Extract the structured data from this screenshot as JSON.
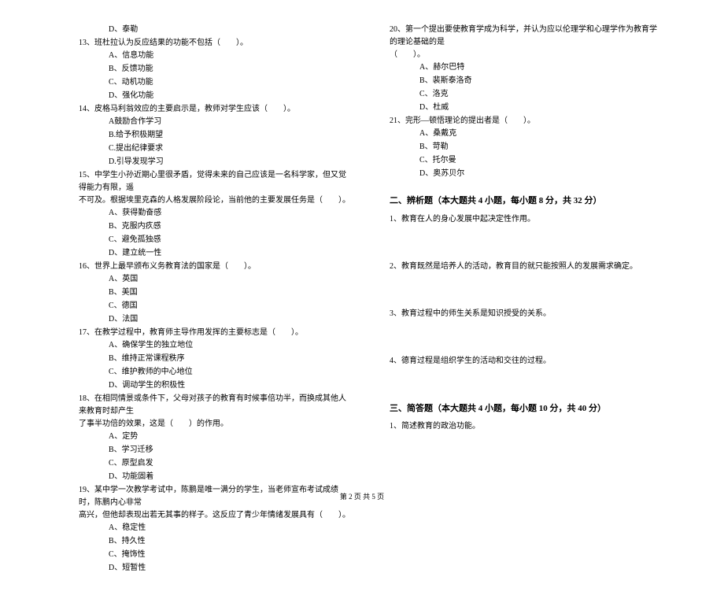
{
  "left": {
    "q12_optD": "D、泰勒",
    "q13_stem": "13、班杜拉认为反应结果的功能不包括（　　）。",
    "q13_A": "A、信息功能",
    "q13_B": "B、反馈功能",
    "q13_C": "C、动机功能",
    "q13_D": "D、强化功能",
    "q14_stem": "14、皮格马利翁效应的主要启示是，教师对学生应该（　　）。",
    "q14_A": "A鼓励合作学习",
    "q14_B": "B.给予积极期望",
    "q14_C": "C.提出纪律要求",
    "q14_D": "D.引导发现学习",
    "q15_stem1": "15、中学生小孙近期心里很矛盾，觉得未来的自己应该是一名科学家，但又觉得能力有限，遥",
    "q15_stem2": "不可及。根据埃里克森的人格发展阶段论，当前他的主要发展任务是（　　）。",
    "q15_A": "A、获得勤奋感",
    "q15_B": "B、克服内疚感",
    "q15_C": "C、避免孤独感",
    "q15_D": "D、建立统一性",
    "q16_stem": "16、世界上最早颁布义务教育法的国家是（　　）。",
    "q16_A": "A、英国",
    "q16_B": "B、美国",
    "q16_C": "C、德国",
    "q16_D": "D、法国",
    "q17_stem": "17、在教学过程中，教育师主导作用发挥的主要标志是（　　）。",
    "q17_A": "A、确保学生的独立地位",
    "q17_B": "B、维持正常课程秩序",
    "q17_C": "C、维护教师的中心地位",
    "q17_D": "D、调动学生的积极性",
    "q18_stem1": "18、在相同情景或条件下，父母对孩子的教育有时候事倍功半，而换成其他人来教育时却产生",
    "q18_stem2": "了事半功倍的效果，这是（　　）的作用。",
    "q18_A": "A、定势",
    "q18_B": "B、学习迁移",
    "q18_C": "C、原型启发",
    "q18_D": "D、功能固着",
    "q19_stem1": "19、某中学一次教学考试中，陈鹏是唯一满分的学生，当老师宣布考试成绩时，陈鹏内心非常",
    "q19_stem2": "高兴，但他却表现出若无其事的样子。这反应了青少年情绪发展具有（　　）。",
    "q19_A": "A、稳定性",
    "q19_B": "B、持久性",
    "q19_C": "C、掩饰性",
    "q19_D": "D、短暂性"
  },
  "right": {
    "q20_stem1": "20、第一个提出要使教育学成为科学，并认为应以伦理学和心理学作为教育学的理论基础的是",
    "q20_stem2": "（　　）。",
    "q20_A": "A、赫尔巴特",
    "q20_B": "B、裴斯泰洛奇",
    "q20_C": "C、洛克",
    "q20_D": "D、杜威",
    "q21_stem": "21、完形—顿悟理论的提出者是（　　）。",
    "q21_A": "A、桑戴克",
    "q21_B": "B、苛勒",
    "q21_C": "C、托尔曼",
    "q21_D": "D、奥苏贝尔",
    "section2_title": "二、辨析题（本大题共 4 小题，每小题 8 分，共 32 分）",
    "s2_q1": "1、教育在人的身心发展中起决定性作用。",
    "s2_q2": "2、教育既然是培养人的活动，教育目的就只能按照人的发展需求确定。",
    "s2_q3": "3、教育过程中的师生关系是知识授受的关系。",
    "s2_q4": "4、德育过程是组织学生的活动和交往的过程。",
    "section3_title": "三、简答题（本大题共 4 小题，每小题 10 分，共 40 分）",
    "s3_q1": "1、简述教育的政治功能。"
  },
  "footer": "第 2 页 共 5 页"
}
